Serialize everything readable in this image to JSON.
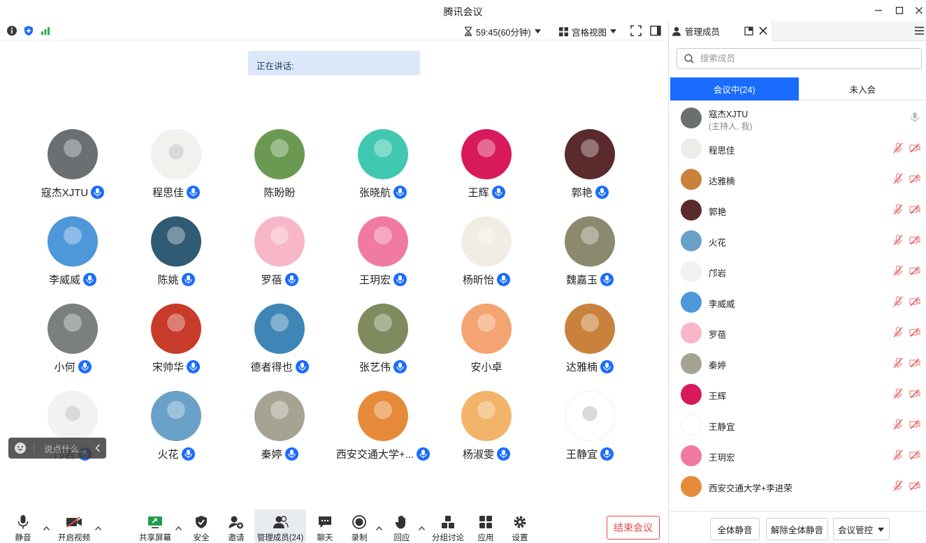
{
  "app": {
    "title": "腾讯会议"
  },
  "topbar": {
    "timer": "59:45(60分钟)",
    "view_label": "宫格视图"
  },
  "speaking": {
    "label": "正在讲话:"
  },
  "participants": [
    {
      "name": "寇杰XJTU",
      "color": "#6b6f72"
    },
    {
      "name": "程思佳",
      "color": "#f3f1ee"
    },
    {
      "name": "陈盼盼",
      "color": "#6a9a52"
    },
    {
      "name": "张晓航",
      "color": "#41c8b0"
    },
    {
      "name": "王辉",
      "color": "#d81a5c"
    },
    {
      "name": "郭艳",
      "color": "#5a2a2c"
    },
    {
      "name": "李威威",
      "color": "#4e97d8"
    },
    {
      "name": "陈姚",
      "color": "#2f5b74"
    },
    {
      "name": "罗蓓",
      "color": "#f7b7c8"
    },
    {
      "name": "王玥宏",
      "color": "#f07aa0"
    },
    {
      "name": "杨昕怡",
      "color": "#f2ede4"
    },
    {
      "name": "魏嘉玉",
      "color": "#8c8a6e"
    },
    {
      "name": "小何",
      "color": "#7b7f80"
    },
    {
      "name": "宋帅华",
      "color": "#c83a2a"
    },
    {
      "name": "德者得也",
      "color": "#3f86b6"
    },
    {
      "name": "张艺伟",
      "color": "#7f8a5e"
    },
    {
      "name": "安小卓",
      "color": "#f4a372"
    },
    {
      "name": "达雅楠",
      "color": "#c9823c"
    },
    {
      "name": "邝岩",
      "color": "#f2f2f2"
    },
    {
      "name": "火花",
      "color": "#6aa1c8"
    },
    {
      "name": "秦婷",
      "color": "#a7a394"
    },
    {
      "name": "西安交通大学+...",
      "color": "#e68a3a"
    },
    {
      "name": "杨淑雯",
      "color": "#f2b36a"
    },
    {
      "name": "王静宜",
      "color": "#ffffff"
    }
  ],
  "chat": {
    "placeholder": "说点什么..."
  },
  "toolbar": {
    "mute": "静音",
    "video": "开启视频",
    "share": "共享屏幕",
    "security": "安全",
    "invite": "邀请",
    "manage": "管理成员(24)",
    "chat": "聊天",
    "record": "录制",
    "react": "回应",
    "breakout": "分组讨论",
    "apps": "应用",
    "settings": "设置",
    "end": "结束会议"
  },
  "panel": {
    "tab_title": "管理成员",
    "search_placeholder": "搜索成员",
    "tabs": {
      "in_meeting": "会议中(24)",
      "not_joined": "未入会"
    },
    "host": {
      "name": "寇杰XJTU",
      "sub": "(主持人, 我)",
      "color": "#6b6f72"
    },
    "members": [
      {
        "name": "程思佳",
        "color": "#efece8"
      },
      {
        "name": "达雅楠",
        "color": "#c9823c"
      },
      {
        "name": "郭艳",
        "color": "#5a2a2c"
      },
      {
        "name": "火花",
        "color": "#6aa1c8"
      },
      {
        "name": "邝岩",
        "color": "#f2f2f2"
      },
      {
        "name": "李威威",
        "color": "#4e97d8"
      },
      {
        "name": "罗蓓",
        "color": "#f7b7c8"
      },
      {
        "name": "秦婷",
        "color": "#a7a394"
      },
      {
        "name": "王辉",
        "color": "#d81a5c"
      },
      {
        "name": "王静宜",
        "color": "#ffffff"
      },
      {
        "name": "王玥宏",
        "color": "#f07aa0"
      },
      {
        "name": "西安交通大学+李进荣",
        "color": "#e68a3a"
      }
    ],
    "footer": {
      "mute_all": "全体静音",
      "unmute_all": "解除全体静音",
      "controls": "会议管控"
    }
  },
  "colors": {
    "accent": "#1a6cff",
    "danger": "#e24a4a",
    "signal": "#27b34a"
  }
}
